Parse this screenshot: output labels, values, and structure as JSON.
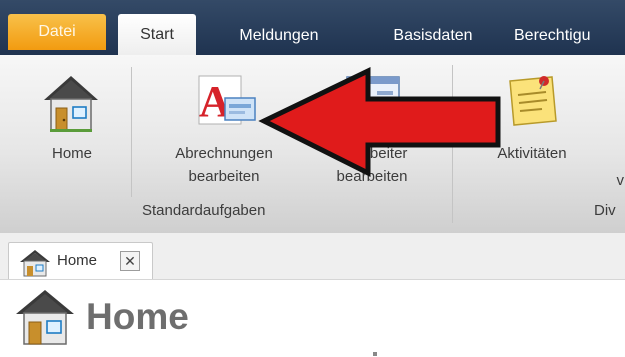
{
  "tabs": {
    "datei": "Datei",
    "start": "Start",
    "meldungen": "Meldungen",
    "basisdaten": "Basisdaten",
    "berechtigungen": "Berechtigu"
  },
  "ribbon": {
    "home_label": "Home",
    "abrechnungen_line1": "Abrechnungen",
    "abrechnungen_line2": "bearbeiten",
    "mitarbeiter_line1": "Mitarbeiter",
    "mitarbeiter_line2": "bearbeiten",
    "aktivitaeten_label": "Aktivitäten",
    "partial_v": "v",
    "group_standardaufgaben": "Standardaufgaben",
    "group_div": "Div"
  },
  "doc_tab": {
    "label": "Home",
    "close": "✕"
  },
  "page": {
    "title": "Home"
  },
  "colors": {
    "tabbar": "#2a3e5c",
    "datei_tab": "#f4a821",
    "arrow_fill": "#e01b1b",
    "title_text": "#6e6e6e"
  },
  "icons": {
    "home": "house-icon",
    "abrechnungen": "letter-a-document-icon",
    "mitarbeiter": "employee-window-icon",
    "aktivitaeten": "sticky-note-pin-icon",
    "annotation": "red-arrow-left"
  }
}
